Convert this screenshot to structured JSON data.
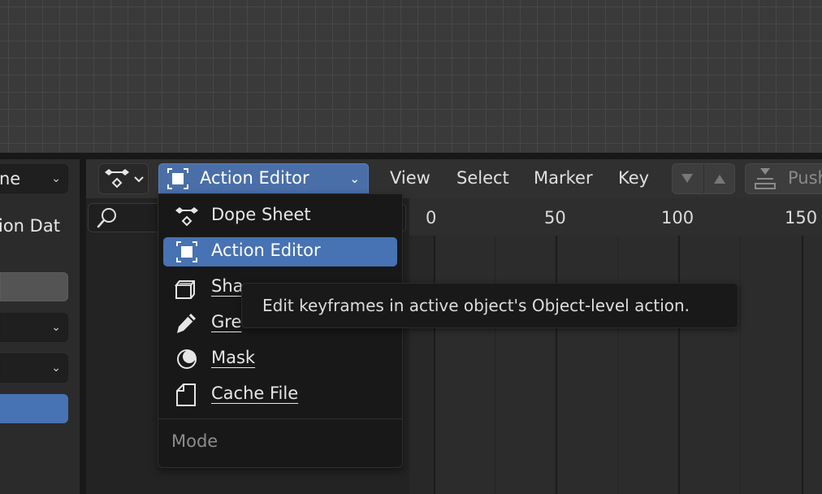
{
  "left_panel": {
    "dropdown_1_text": "ne",
    "label_text": "ion Dat"
  },
  "header": {
    "editor_type_icon": "dope-sheet-icon",
    "mode_dropdown": {
      "label": "Action Editor",
      "icon": "action-editor-icon"
    },
    "menus": [
      "View",
      "Select",
      "Marker",
      "Key"
    ],
    "push_down_label": "Push"
  },
  "timeline": {
    "frame_labels": [
      "0",
      "50",
      "100",
      "150"
    ]
  },
  "mode_menu": {
    "items": [
      {
        "label": "Dope Sheet",
        "icon": "dope-sheet-icon",
        "active": false
      },
      {
        "label": "Action Editor",
        "icon": "action-editor-icon",
        "active": true
      },
      {
        "label": "Sha",
        "icon": "shape-key-icon",
        "active": false
      },
      {
        "label": "Gre",
        "icon": "grease-pencil-icon",
        "active": false
      },
      {
        "label": "Mask",
        "icon": "mask-icon",
        "active": false
      },
      {
        "label": "Cache File",
        "icon": "cache-file-icon",
        "active": false
      }
    ],
    "heading": "Mode"
  },
  "tooltip": {
    "text": "Edit keyframes in active object's Object-level action."
  },
  "colors": {
    "accent": "#4772b3",
    "dropdown_active": "#4a6fa8",
    "menu_bg": "#181818"
  }
}
